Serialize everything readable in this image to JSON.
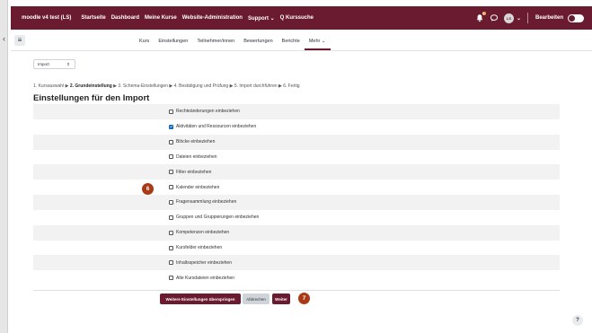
{
  "navbar": {
    "site_name": "moodle v4 test (LS)",
    "links": [
      "Startseite",
      "Dashboard",
      "Meine Kurse",
      "Website-Administration",
      "Support ⌄",
      "Q  Kurssuche"
    ],
    "user_initials": "LS",
    "edit_mode_label": "Bearbeiten",
    "notification_count": "0",
    "bar_color": "#6a1b2f"
  },
  "secondary_nav": {
    "items": [
      "Kurs",
      "Einstellungen",
      "Teilnehmer/innen",
      "Bewertungen",
      "Berichte",
      "Mehr ⌄"
    ],
    "active_index": 5
  },
  "import_select": {
    "value": "Import"
  },
  "progress": {
    "step1": "1. Kursauswahl ▶ ",
    "step2": "2. Grundeinstellung",
    "rest": " ▶ 3. Schema-Einstellungen ▶ 4. Bestätigung und Prüfung ▶ 5. Import durchführen ▶ 6. Fertig"
  },
  "page_title": "Einstellungen für den Import",
  "options": [
    {
      "label": "Rechteänderungen einbeziehen",
      "checked": false
    },
    {
      "label": "Aktivitäten und Ressourcen einbeziehen",
      "checked": true
    },
    {
      "label": "Blöcke einbeziehen",
      "checked": false
    },
    {
      "label": "Dateien einbeziehen",
      "checked": false
    },
    {
      "label": "Filter einbeziehen",
      "checked": false
    },
    {
      "label": "Kalender einbeziehen",
      "checked": false
    },
    {
      "label": "Fragensammlung einbeziehen",
      "checked": false
    },
    {
      "label": "Gruppen und Gruppierungen einbeziehen",
      "checked": false
    },
    {
      "label": "Kompetenzen einbeziehen",
      "checked": false
    },
    {
      "label": "Kursfelder einbeziehen",
      "checked": false
    },
    {
      "label": "Inhaltsspeicher einbeziehen",
      "checked": false
    },
    {
      "label": "Alte Kursdateien einbeziehen",
      "checked": false
    }
  ],
  "markers": {
    "options_step": "6",
    "buttons_step": "7"
  },
  "buttons": {
    "skip": "Weitere Einstellungen überspringen",
    "cancel": "Abbrechen",
    "next": "Weiter"
  },
  "help_label": "?"
}
